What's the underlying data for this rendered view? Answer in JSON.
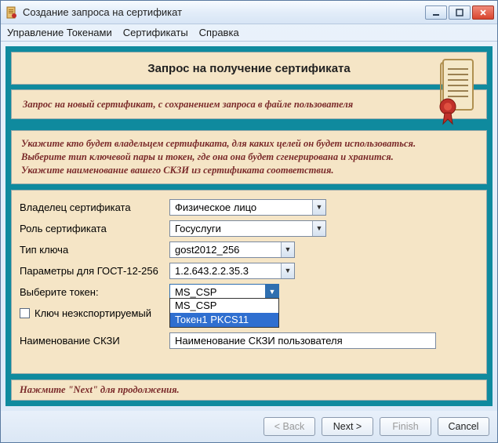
{
  "window": {
    "title": "Создание запроса на сертификат"
  },
  "menu": {
    "tokens": "Управление Токенами",
    "certs": "Сертификаты",
    "help": "Справка"
  },
  "banner": {
    "title": "Запрос на получение сертификата",
    "subtitle": "Запрос на новый сертификат, с сохранением запроса в файле пользователя"
  },
  "instructions": {
    "line1": "Укажите кто будет владельцем сертификата, для каких целей он будет использоваться.",
    "line2": "Выберите тип ключевой пары и токен, где она она будет сгенерирована и хранится.",
    "line3": "Укажите наименование вашего СКЗИ из сертификата соответствия."
  },
  "form": {
    "owner_label": "Владелец сертификата",
    "owner_value": "Физическое лицо",
    "role_label": "Роль сертификата",
    "role_value": "Госуслуги",
    "keytype_label": "Тип ключа",
    "keytype_value": "gost2012_256",
    "params_label": "Параметры для ГОСТ-12-256",
    "params_value": "1.2.643.2.2.35.3",
    "token_label": "Выберите токен:",
    "token_value": "MS_CSP",
    "token_options": {
      "o0": "MS_CSP",
      "o1": "Токен1 PKCS11"
    },
    "nonexport_label": "Ключ неэкспортируемый",
    "skzi_label": "Наименование СКЗИ",
    "skzi_value": "Наименование СКЗИ пользователя"
  },
  "hint": "Нажмите \"Next\" для продолжения.",
  "buttons": {
    "back": "< Back",
    "next": "Next >",
    "finish": "Finish",
    "cancel": "Cancel"
  }
}
